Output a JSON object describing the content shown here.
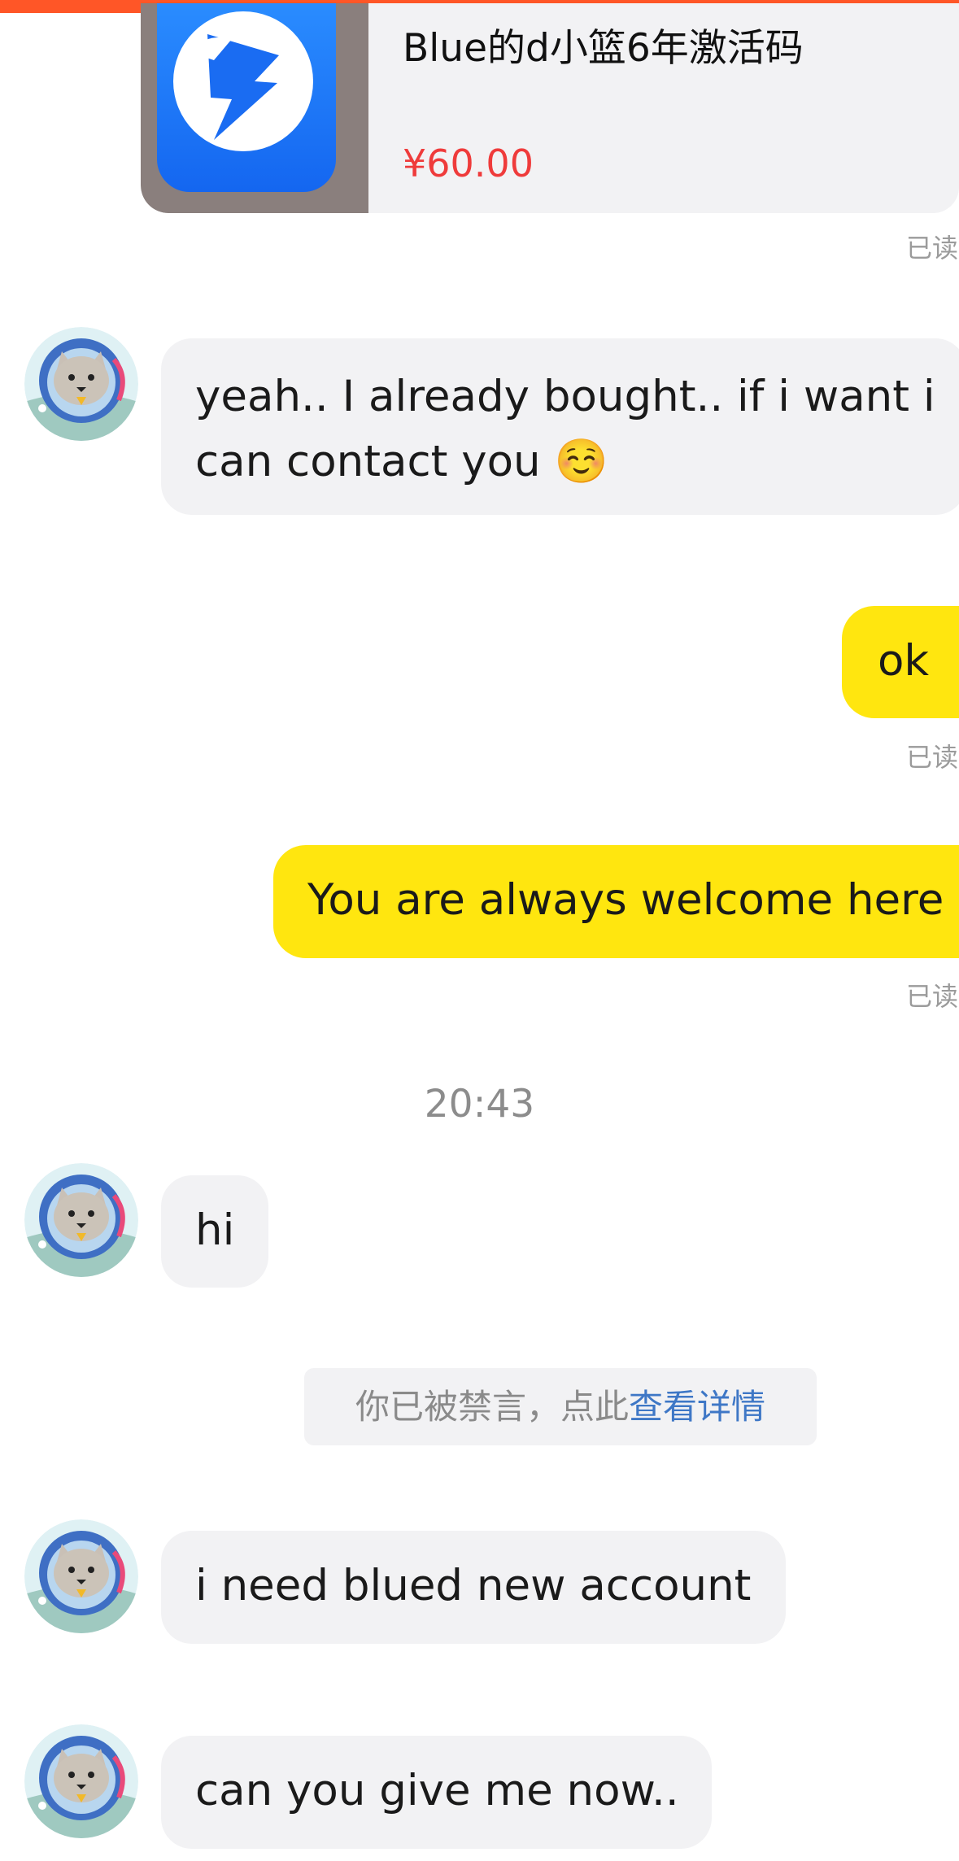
{
  "product": {
    "title": "Blue的d小篮6年激活码",
    "price": "¥60.00",
    "icon": "blued-app-icon"
  },
  "messages": [
    {
      "sender": "other",
      "text_lines": [
        "yeah.. I already bought.. if i want i",
        "can contact you"
      ],
      "emoji": "☺️"
    },
    {
      "sender": "me",
      "text": "ok",
      "status": "已读"
    },
    {
      "sender": "me",
      "text": "You are always welcome here",
      "status": "已读"
    },
    {
      "sender": "other",
      "text": "hi"
    },
    {
      "sender": "other",
      "text": "i need blued new account"
    },
    {
      "sender": "other",
      "text": "can you give me now.."
    }
  ],
  "product_status": "已读",
  "time_label": "20:43",
  "notice": {
    "text": "你已被禁言，点此",
    "link": "查看详情"
  },
  "colors": {
    "top_bar": "#ff5627",
    "outgoing_bubble": "#ffe60f",
    "incoming_bubble": "#f2f2f4",
    "price": "#ef3b3b",
    "link": "#3e77c6"
  }
}
